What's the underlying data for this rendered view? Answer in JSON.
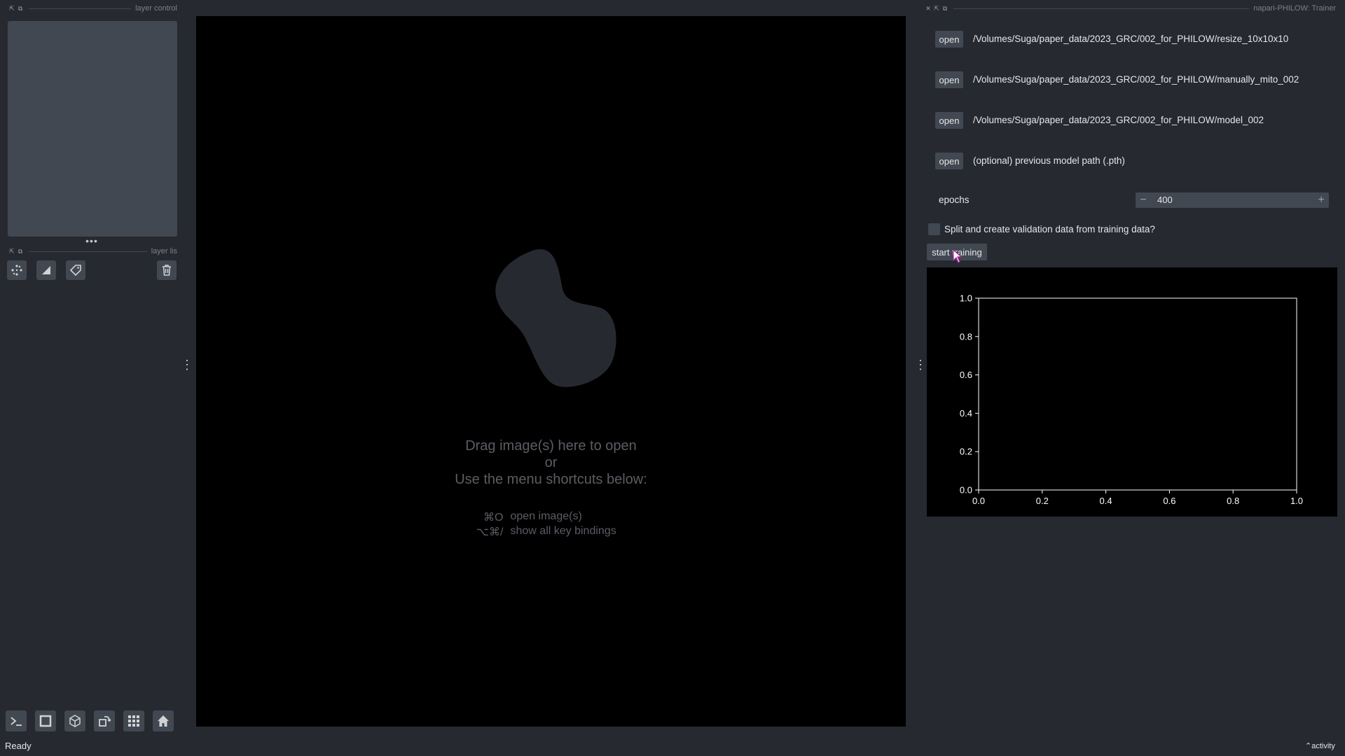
{
  "left_dock": {
    "layer_controls_title": "layer control",
    "layer_list_title": "layer lis",
    "tools": [
      "points-icon",
      "shapes-icon",
      "labels-icon",
      "trash-icon"
    ]
  },
  "bottom_bar": {
    "buttons": [
      "console-icon",
      "ndisplay-square-icon",
      "3d-cube-icon",
      "roll-icon",
      "grid-icon",
      "home-icon"
    ]
  },
  "canvas": {
    "welcome_line1": "Drag image(s) here to open",
    "welcome_line2": "or",
    "welcome_line3": "Use the menu shortcuts below:",
    "shortcuts": [
      {
        "key": "⌘O",
        "label": "open image(s)"
      },
      {
        "key": "⌥⌘/",
        "label": "show all key bindings"
      }
    ]
  },
  "trainer": {
    "title": "napari-PHILOW: Trainer",
    "open_label": "open",
    "paths": [
      "/Volumes/Suga/paper_data/2023_GRC/002_for_PHILOW/resize_10x10x10",
      "/Volumes/Suga/paper_data/2023_GRC/002_for_PHILOW/manually_mito_002",
      "/Volumes/Suga/paper_data/2023_GRC/002_for_PHILOW/model_002",
      "(optional) previous model path (.pth)"
    ],
    "epochs_label": "epochs",
    "epochs_value": "400",
    "split_label": "Split and create validation data from training data?",
    "split_checked": false,
    "start_label": "start training"
  },
  "chart_data": {
    "type": "line",
    "series": [],
    "xlim": [
      0.0,
      1.0
    ],
    "ylim": [
      0.0,
      1.0
    ],
    "xticks": [
      "0.0",
      "0.2",
      "0.4",
      "0.6",
      "0.8",
      "1.0"
    ],
    "yticks": [
      "0.0",
      "0.2",
      "0.4",
      "0.6",
      "0.8",
      "1.0"
    ],
    "title": "",
    "xlabel": "",
    "ylabel": "",
    "background": "#000000",
    "axis_color": "#ffffff"
  },
  "status": {
    "text": "Ready",
    "activity_label": "activity"
  }
}
